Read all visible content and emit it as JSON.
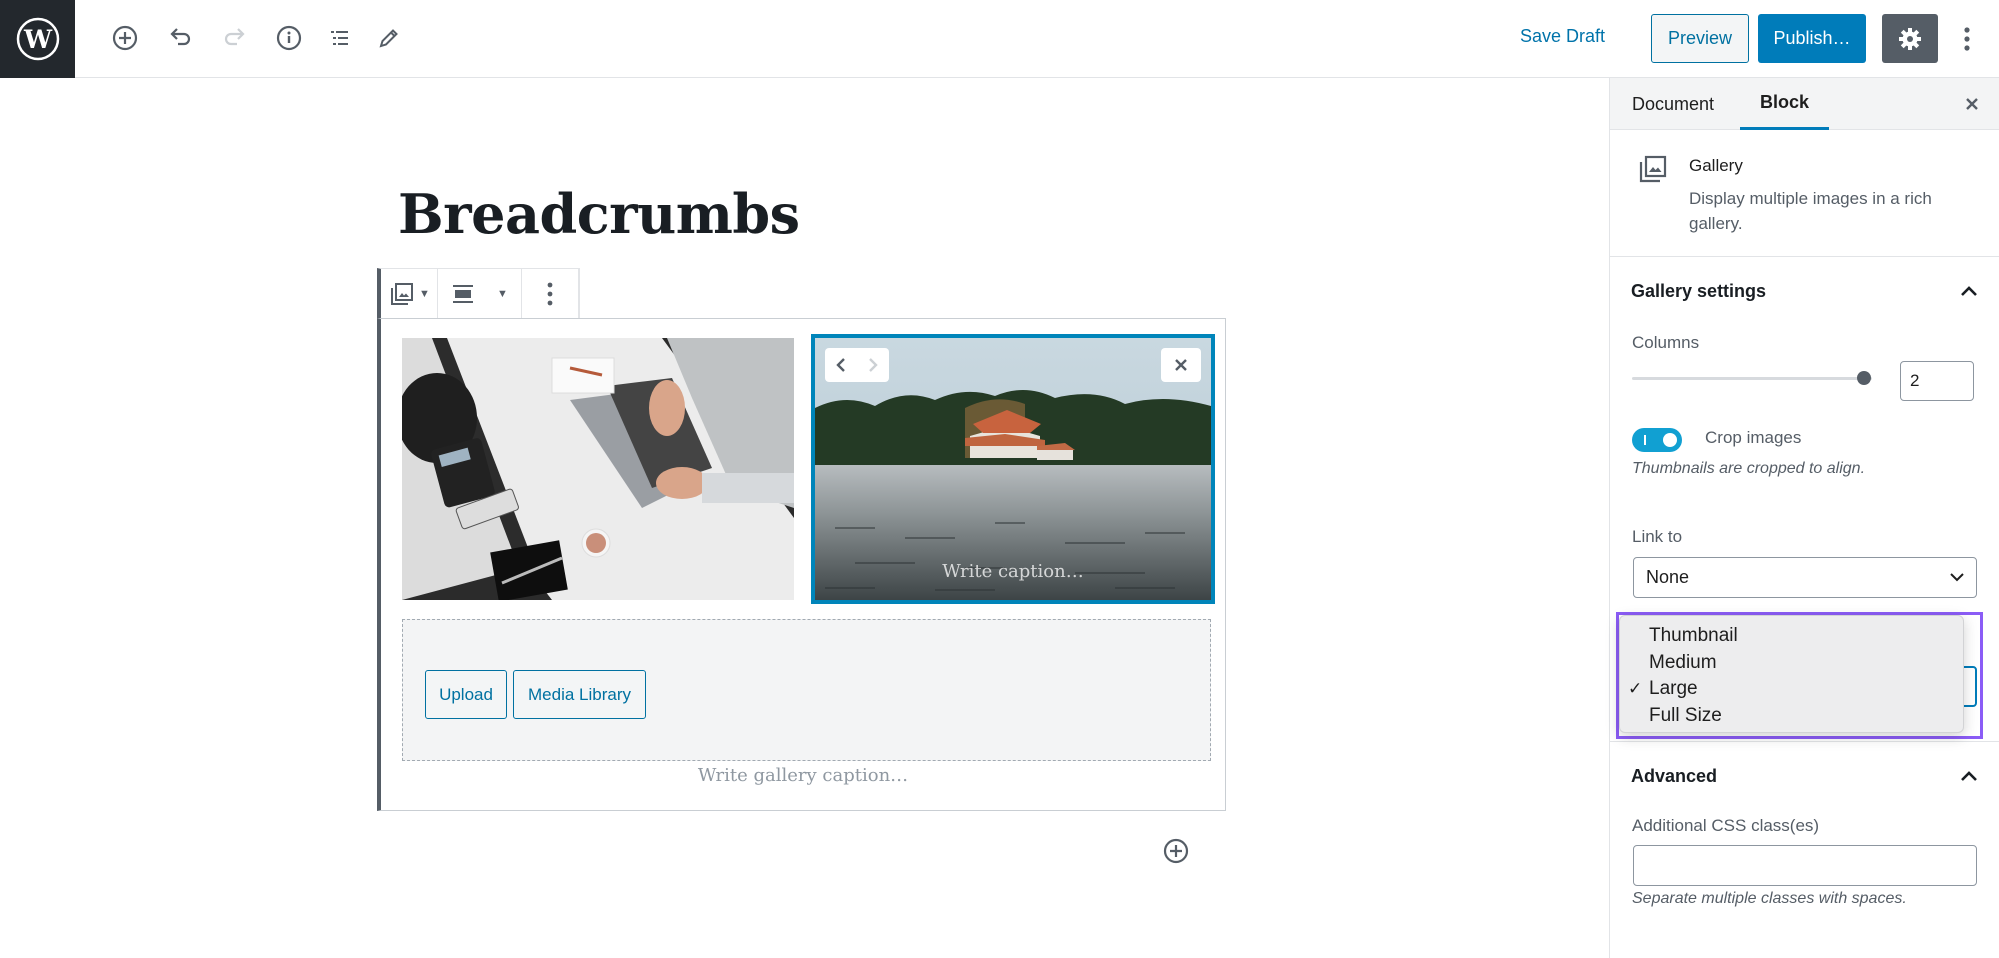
{
  "header": {
    "toolbar_icons": [
      "wordpress-logo",
      "add-block-icon",
      "undo-icon",
      "redo-icon",
      "info-icon",
      "block-navigation-icon",
      "edit-tools-icon"
    ],
    "save_draft": "Save Draft",
    "preview": "Preview",
    "publish": "Publish…",
    "settings_icon": "gear-icon",
    "more_icon": "more-vertical-icon"
  },
  "editor": {
    "post_title": "Breadcrumbs",
    "block_toolbar": {
      "block_type_icon": "gallery-icon",
      "align_icon": "align-wide-icon",
      "more_icon": "more-vertical-icon"
    },
    "gallery": {
      "images": [
        {
          "alt": "Person typing on a laptop at a white desk",
          "selected": false,
          "caption": ""
        },
        {
          "alt": "House by a lake surrounded by trees",
          "selected": true,
          "caption_placeholder": "Write caption…"
        }
      ],
      "upload_button": "Upload",
      "media_library_button": "Media Library",
      "caption_placeholder": "Write gallery caption…"
    }
  },
  "sidebar": {
    "tabs": [
      {
        "label": "Document",
        "active": false
      },
      {
        "label": "Block",
        "active": true
      }
    ],
    "block_card": {
      "title": "Gallery",
      "description": "Display multiple images in a rich gallery."
    },
    "gallery_settings": {
      "title": "Gallery settings",
      "columns_label": "Columns",
      "columns_value": "2",
      "columns_min": 1,
      "columns_max": 2,
      "crop_label": "Crop images",
      "crop_enabled": true,
      "crop_help": "Thumbnails are cropped to align.",
      "link_to_label": "Link to",
      "link_to_value": "None",
      "image_size_options": [
        "Thumbnail",
        "Medium",
        "Large",
        "Full Size"
      ],
      "image_size_selected": "Large"
    },
    "advanced": {
      "title": "Advanced",
      "css_label": "Additional CSS class(es)",
      "css_value": "",
      "css_help": "Separate multiple classes with spaces."
    }
  },
  "colors": {
    "accent": "#007cba",
    "dark": "#23282d",
    "highlight": "#8b5cf6"
  }
}
